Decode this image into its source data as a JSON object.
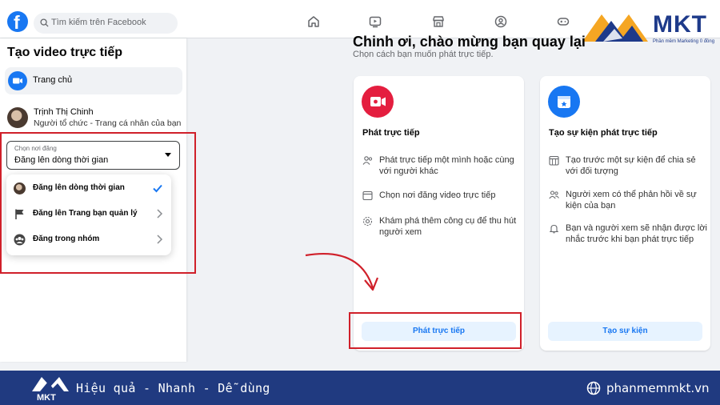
{
  "topbar": {
    "logo_letter": "f",
    "search_placeholder": "Tìm kiếm trên Facebook",
    "nav_icons": [
      "home-icon",
      "video-icon",
      "marketplace-icon",
      "groups-icon",
      "gaming-icon"
    ]
  },
  "brand": {
    "name": "MKT",
    "tagline": "Phần mềm Marketing 0 đồng",
    "color": "#1e3a8a",
    "accent": "#f5a623"
  },
  "sidebar": {
    "title": "Tạo video trực tiếp",
    "home_label": "Trang chủ",
    "user": {
      "name": "Trịnh Thị Chinh",
      "role": "Người tổ chức - Trang cá nhân của bạn"
    },
    "privacy_select": {
      "caption": "Chọn nơi đăng",
      "value": "Đăng lên dòng thời gian"
    },
    "dropdown_items": [
      {
        "label": "Đăng lên dòng thời gian",
        "icon": "avatar-icon",
        "right_icon": "check-icon"
      },
      {
        "label": "Đăng lên Trang bạn quản lý",
        "icon": "flag-icon",
        "right_icon": "chevron-right-icon"
      },
      {
        "label": "Đăng trong nhóm",
        "icon": "group-icon",
        "right_icon": "chevron-right-icon"
      }
    ]
  },
  "main": {
    "welcome": "Chinh ơi, chào mừng bạn quay lại",
    "subtitle": "Chọn cách bạn muốn phát trực tiếp.",
    "cards": [
      {
        "title": "Phát trực tiếp",
        "icon": "live-video-icon",
        "icon_color": "#e41e3f",
        "features": [
          {
            "icon": "person-icon",
            "text": "Phát trực tiếp một mình hoặc cùng với người khác"
          },
          {
            "icon": "window-icon",
            "text": "Chọn nơi đăng video trực tiếp"
          },
          {
            "icon": "settings-icon",
            "text": "Khám phá thêm công cụ để thu hút người xem"
          }
        ],
        "button": "Phát trực tiếp"
      },
      {
        "title": "Tạo sự kiện phát trực tiếp",
        "icon": "calendar-star-icon",
        "icon_color": "#1877f2",
        "features": [
          {
            "icon": "calendar-icon",
            "text": "Tạo trước một sự kiện để chia sẻ với đối tượng"
          },
          {
            "icon": "people-icon",
            "text": "Người xem có thể phản hồi về sự kiện của bạn"
          },
          {
            "icon": "bell-icon",
            "text": "Bạn và người xem sẽ nhận được lời nhắc trước khi bạn phát trực tiếp"
          }
        ],
        "button": "Tạo sự kiện"
      }
    ]
  },
  "footer": {
    "tagline": "Hiệu quả - Nhanh - Dễ dùng",
    "website": "phanmemmkt.vn",
    "background": "#203a80"
  },
  "annotation_color": "#d0202a"
}
